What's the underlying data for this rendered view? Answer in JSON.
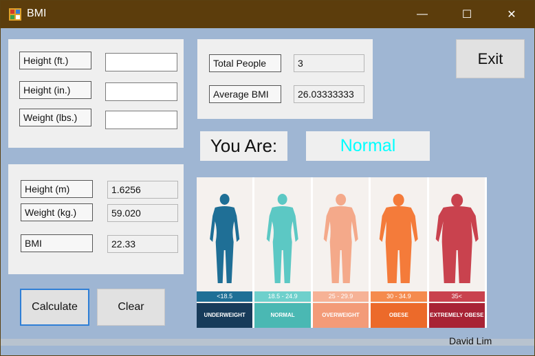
{
  "window": {
    "title": "BMI",
    "minimize_glyph": "—",
    "maximize_glyph": "☐",
    "close_glyph": "✕"
  },
  "input_panel": {
    "height_ft_label": "Height (ft.)",
    "height_in_label": "Height (in.)",
    "weight_lbs_label": "Weight (lbs.)",
    "height_ft_value": "",
    "height_in_value": "",
    "weight_lbs_value": ""
  },
  "results_panel": {
    "height_m_label": "Height (m)",
    "height_m_value": "1.6256",
    "weight_kg_label": "Weight (kg.)",
    "weight_kg_value": "59.020",
    "bmi_label": "BMI",
    "bmi_value": "22.33"
  },
  "stats_panel": {
    "total_people_label": "Total People",
    "total_people_value": "3",
    "average_bmi_label": "Average BMI",
    "average_bmi_value": "26.03333333"
  },
  "status": {
    "you_are_label": "You Are:",
    "result": "Normal",
    "result_color": "#00ffff"
  },
  "buttons": {
    "exit": "Exit",
    "calculate": "Calculate",
    "clear": "Clear"
  },
  "chart_image": {
    "categories": [
      {
        "range": "<18.5",
        "name": "UNDERWEIGHT",
        "body_color": "#1f6f96",
        "range_bg": "#1f6f96",
        "name_bg": "#173b5a"
      },
      {
        "range": "18.5 - 24.9",
        "name": "NORMAL",
        "body_color": "#5cc8c4",
        "range_bg": "#6ed0cc",
        "name_bg": "#4ab8b3"
      },
      {
        "range": "25 - 29.9",
        "name": "OVERWEIGHT",
        "body_color": "#f4a98a",
        "range_bg": "#f6b296",
        "name_bg": "#f39b78"
      },
      {
        "range": "30 - 34.9",
        "name": "OBESE",
        "body_color": "#f47b3a",
        "range_bg": "#f58b4e",
        "name_bg": "#ec6a2a"
      },
      {
        "range": "35<",
        "name": "EXTREMELY OBESE",
        "body_color": "#c9424e",
        "range_bg": "#c9424e",
        "name_bg": "#a82335"
      }
    ]
  },
  "footer": {
    "author": "David Lim"
  }
}
